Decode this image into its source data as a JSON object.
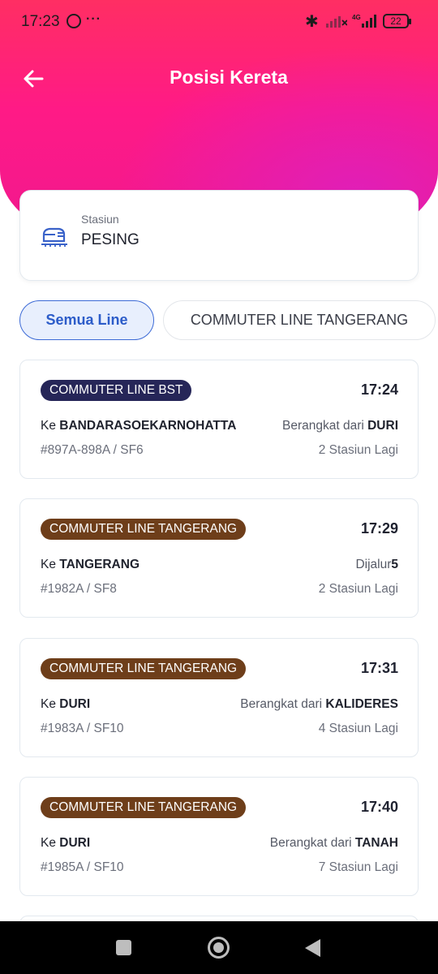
{
  "status_bar": {
    "time": "17:23",
    "dots": "···",
    "battery": "22",
    "network": "4G"
  },
  "header": {
    "title": "Posisi Kereta"
  },
  "station": {
    "label": "Stasiun",
    "name": "PESING"
  },
  "filters": [
    {
      "label": "Semua Line",
      "active": true
    },
    {
      "label": "COMMUTER LINE TANGERANG",
      "active": false
    }
  ],
  "colors": {
    "header_gradient_start": "#ff2e63",
    "header_gradient_end": "#e01fb8",
    "badge_bst": "#262658",
    "badge_tangerang": "#6e3e1a",
    "chip_active_border": "#3c6ad6"
  },
  "trains": [
    {
      "line": "COMMUTER LINE BST",
      "line_color": "#262658",
      "time": "17:24",
      "dest_prefix": "Ke ",
      "destination": "BANDARASOEKARNOHATTA",
      "dep_prefix": "Berangkat dari ",
      "dep_value": "DURI",
      "train_no": "#897A-898A / SF6",
      "remaining": "2 Stasiun Lagi"
    },
    {
      "line": "COMMUTER LINE TANGERANG",
      "line_color": "#6e3e1a",
      "time": "17:29",
      "dest_prefix": "Ke ",
      "destination": "TANGERANG",
      "dep_prefix": "Dijalur",
      "dep_value": "5",
      "train_no": "#1982A / SF8",
      "remaining": "2 Stasiun Lagi"
    },
    {
      "line": "COMMUTER LINE TANGERANG",
      "line_color": "#6e3e1a",
      "time": "17:31",
      "dest_prefix": "Ke ",
      "destination": "DURI",
      "dep_prefix": "Berangkat dari ",
      "dep_value": "KALIDERES",
      "train_no": "#1983A / SF10",
      "remaining": "4 Stasiun Lagi"
    },
    {
      "line": "COMMUTER LINE TANGERANG",
      "line_color": "#6e3e1a",
      "time": "17:40",
      "dest_prefix": "Ke ",
      "destination": "DURI",
      "dep_prefix": "Berangkat dari ",
      "dep_value": "TANAH",
      "train_no": "#1985A / SF10",
      "remaining": "7 Stasiun Lagi"
    }
  ]
}
